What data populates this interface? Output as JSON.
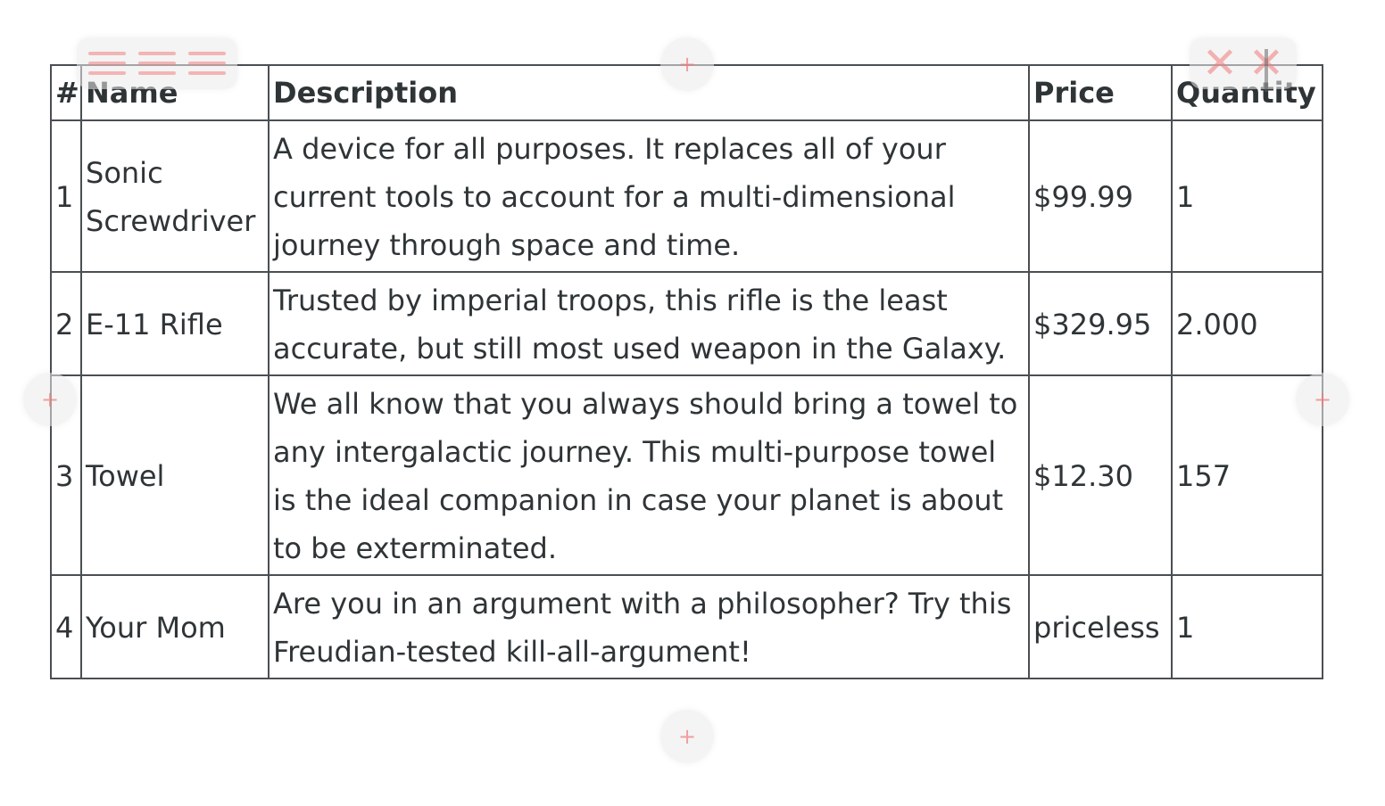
{
  "table": {
    "headers": {
      "num": "#",
      "name": "Name",
      "description": "Description",
      "price": "Price",
      "quantity": "Quantity"
    },
    "rows": [
      {
        "num": "1",
        "name": "Sonic Screwdriver",
        "description": "A device for all purposes. It replaces all of your current tools to account for a multi-dimensional journey through space and time.",
        "price": "$99.99",
        "quantity": "1"
      },
      {
        "num": "2",
        "name": "E-11 Rifle",
        "description": "Trusted by imperial troops, this rifle is the least accurate, but still most used weapon in the Galaxy.",
        "price": "$329.95",
        "quantity": "2.000"
      },
      {
        "num": "3",
        "name": "Towel",
        "description": "We all know that you always should bring a towel to any intergalactic journey. This multi-purpose towel is the ideal companion in case your planet is about to be exterminated.",
        "price": "$12.30",
        "quantity": "157"
      },
      {
        "num": "4",
        "name": "Your Mom",
        "description": "Are you in an argument with a philosopher? Try this Freudian-tested kill-all-argument!",
        "price": "priceless",
        "quantity": "1"
      }
    ]
  },
  "controls": {
    "plus_glyph": "+",
    "close_glyph": "✕"
  },
  "icons": {
    "row_drag": "drag-handle-icon",
    "add_row": "plus-icon",
    "delete": "close-icon"
  },
  "colors": {
    "border": "#4a4f53",
    "text": "#2f3437",
    "control_accent": "#f08282"
  }
}
